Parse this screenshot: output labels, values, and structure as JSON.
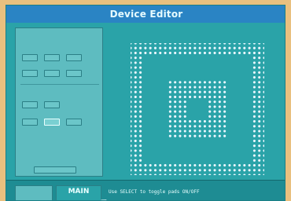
{
  "title": "Device Editor",
  "left_panel": {
    "rows": [
      "",
      ""
    ],
    "buttons_row1": [
      "",
      "",
      ""
    ],
    "buttons_row2": [
      "",
      "",
      ""
    ],
    "section_label": "",
    "buttons_row3": [
      "",
      ""
    ],
    "buttons_row4": [
      "",
      "",
      ""
    ],
    "exit_label": ""
  },
  "status_bar": {
    "main_label": "MAIN",
    "main_sublabel": "",
    "message": "Use SELECT to toggle pads ON/OFF"
  },
  "grid": {
    "dot_color": "#eaf7ff",
    "background_color": "#2aa3a8"
  }
}
